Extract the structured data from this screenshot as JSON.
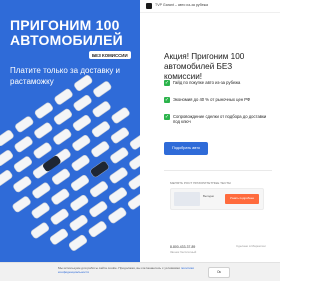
{
  "promo": {
    "title": "ПРИГОНИМ 100 АВТОМОБИЛЕЙ",
    "badge": "БЕЗ КОМИССИИ",
    "subtitle": "Платите только за доставку и растаможку"
  },
  "header": {
    "site_name": "TVP Garant – авто из-за рубежа"
  },
  "offer": {
    "title": "Акция! Пригоним 100 автомобилей БЕЗ комиссии!",
    "features": [
      "Гайд по покупке авто из-за рубежа",
      "Экономия до 40 % от рыночных цен РФ",
      "Сопровождение сделки от подбора до доставки под ключ"
    ],
    "cta_label": "Подобрать авто"
  },
  "ad": {
    "label": "МЕНЯТЬ РОСТ ПРИОРИТЕТНЫЕ ТЕСТЫ",
    "text": "Выгодно",
    "button": "Узнать подробнее"
  },
  "contact": {
    "phone": "8-800-433-37-89",
    "note": "Звонок бесплатный",
    "brand": "Сделано в Маркетинг"
  },
  "cookie": {
    "text_before": "Мы используем для работы сайта cookie. Продолжая, вы соглашаетесь с условиями",
    "link": "политики конфиденциальности",
    "button": "Ок"
  },
  "colors": {
    "accent": "#2f6bd8",
    "check": "#2bb34b",
    "ad_button": "#ff6b3d"
  }
}
